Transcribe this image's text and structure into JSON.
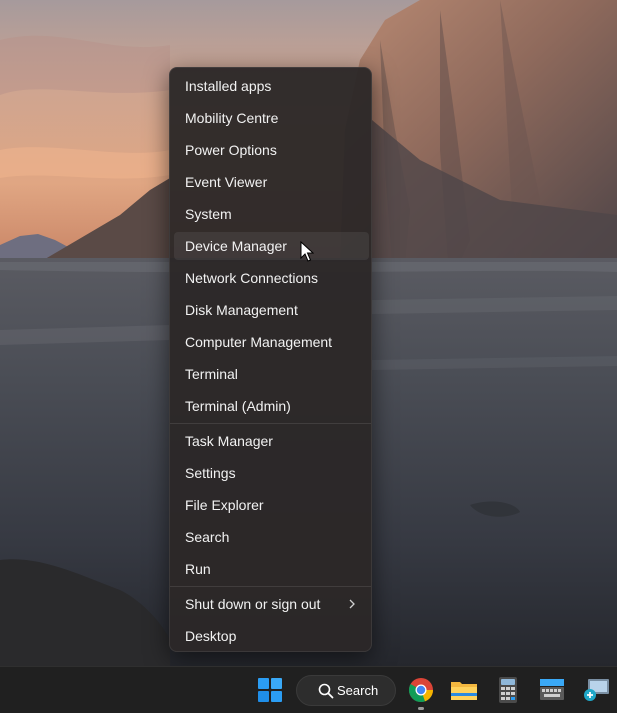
{
  "menu": {
    "items": [
      {
        "label": "Installed apps"
      },
      {
        "label": "Mobility Centre"
      },
      {
        "label": "Power Options"
      },
      {
        "label": "Event Viewer"
      },
      {
        "label": "System"
      },
      {
        "label": "Device Manager"
      },
      {
        "label": "Network Connections"
      },
      {
        "label": "Disk Management"
      },
      {
        "label": "Computer Management"
      },
      {
        "label": "Terminal"
      },
      {
        "label": "Terminal (Admin)"
      },
      {
        "label": "Task Manager"
      },
      {
        "label": "Settings"
      },
      {
        "label": "File Explorer"
      },
      {
        "label": "Search"
      },
      {
        "label": "Run"
      },
      {
        "label": "Shut down or sign out"
      },
      {
        "label": "Desktop"
      }
    ],
    "hovered_item": "Device Manager"
  },
  "taskbar": {
    "search_label": "Search",
    "apps": [
      {
        "name": "Start",
        "icon": "windows-start-icon"
      },
      {
        "name": "Google Chrome",
        "icon": "chrome-icon",
        "running": true
      },
      {
        "name": "File Explorer",
        "icon": "folder-icon"
      },
      {
        "name": "Calculator",
        "icon": "calculator-icon"
      },
      {
        "name": "On-Screen Keyboard",
        "icon": "keyboard-icon"
      },
      {
        "name": "Remote Desktop",
        "icon": "remote-desktop-icon"
      }
    ]
  },
  "colors": {
    "menu_bg": "#2c2828",
    "menu_text": "#f2f2f2",
    "taskbar_bg": "#202020",
    "windows_blue": "#2b9df3"
  }
}
